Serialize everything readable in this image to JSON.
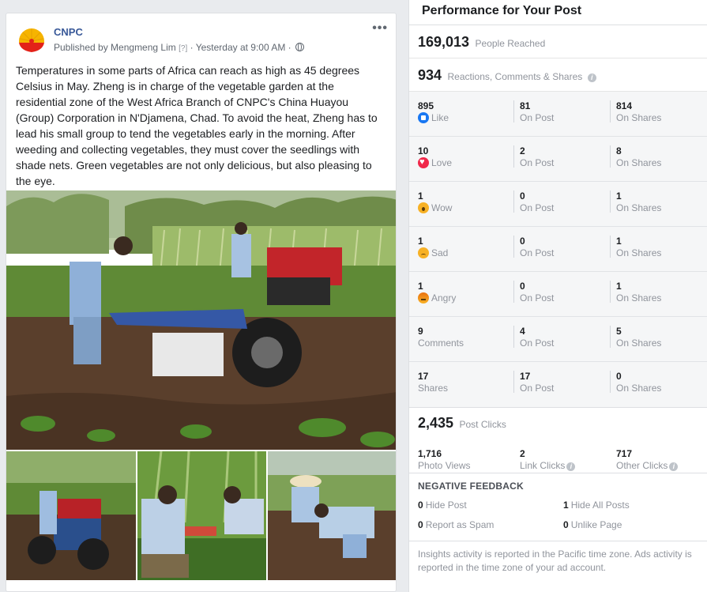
{
  "post": {
    "page_name": "CNPC",
    "published_by": "Published by Mengmeng Lim",
    "help_marker": "[?]",
    "timestamp": "· Yesterday at 9:00 AM ·",
    "more_icon": "ellipsis-icon",
    "body": "Temperatures in some parts of Africa can reach as high as 45 degrees Celsius in May. Zheng is in charge of the vegetable garden at the residential zone of the West Africa Branch of CNPC's China Huayou (Group) Corporation in N'Djamena, Chad. To avoid the heat, Zheng has to lead his small group to tend the vegetables early in the morning. After weeding and collecting vegetables, they must cover the seedlings with shade nets. Green vegetables are not only delicious, but also pleasing to the eye."
  },
  "insights": {
    "title": "Performance for Your Post",
    "reached": {
      "value": "169,013",
      "label": "People Reached"
    },
    "engagement": {
      "value": "934",
      "label": "Reactions, Comments & Shares"
    },
    "rows": [
      {
        "total": "895",
        "label": "Like",
        "icon": "like-icon",
        "on_post": "81",
        "on_post_label": "On Post",
        "on_shares": "814",
        "on_shares_label": "On Shares"
      },
      {
        "total": "10",
        "label": "Love",
        "icon": "love-icon",
        "on_post": "2",
        "on_post_label": "On Post",
        "on_shares": "8",
        "on_shares_label": "On Shares"
      },
      {
        "total": "1",
        "label": "Wow",
        "icon": "wow-icon",
        "on_post": "0",
        "on_post_label": "On Post",
        "on_shares": "1",
        "on_shares_label": "On Shares"
      },
      {
        "total": "1",
        "label": "Sad",
        "icon": "sad-icon",
        "on_post": "0",
        "on_post_label": "On Post",
        "on_shares": "1",
        "on_shares_label": "On Shares"
      },
      {
        "total": "1",
        "label": "Angry",
        "icon": "angry-icon",
        "on_post": "0",
        "on_post_label": "On Post",
        "on_shares": "1",
        "on_shares_label": "On Shares"
      },
      {
        "total": "9",
        "label": "Comments",
        "icon": "",
        "on_post": "4",
        "on_post_label": "On Post",
        "on_shares": "5",
        "on_shares_label": "On Shares"
      },
      {
        "total": "17",
        "label": "Shares",
        "icon": "",
        "on_post": "17",
        "on_post_label": "On Post",
        "on_shares": "0",
        "on_shares_label": "On Shares"
      }
    ],
    "clicks": {
      "value": "2,435",
      "label": "Post Clicks",
      "photo_views": {
        "value": "1,716",
        "label": "Photo Views"
      },
      "link_clicks": {
        "value": "2",
        "label": "Link Clicks"
      },
      "other_clicks": {
        "value": "717",
        "label": "Other Clicks"
      }
    },
    "negative": {
      "title": "NEGATIVE FEEDBACK",
      "hide_post": {
        "value": "0",
        "label": "Hide Post"
      },
      "hide_all": {
        "value": "1",
        "label": "Hide All Posts"
      },
      "spam": {
        "value": "0",
        "label": "Report as Spam"
      },
      "unlike": {
        "value": "0",
        "label": "Unlike Page"
      }
    },
    "footer": "Insights activity is reported in the Pacific time zone. Ads activity is reported in the time zone of your ad account."
  },
  "colors": {
    "link_blue": "#385898",
    "muted": "#90949c",
    "like_blue": "#1877f2",
    "love_red": "#f0284a",
    "reaction_yellow": "#f7b125"
  }
}
